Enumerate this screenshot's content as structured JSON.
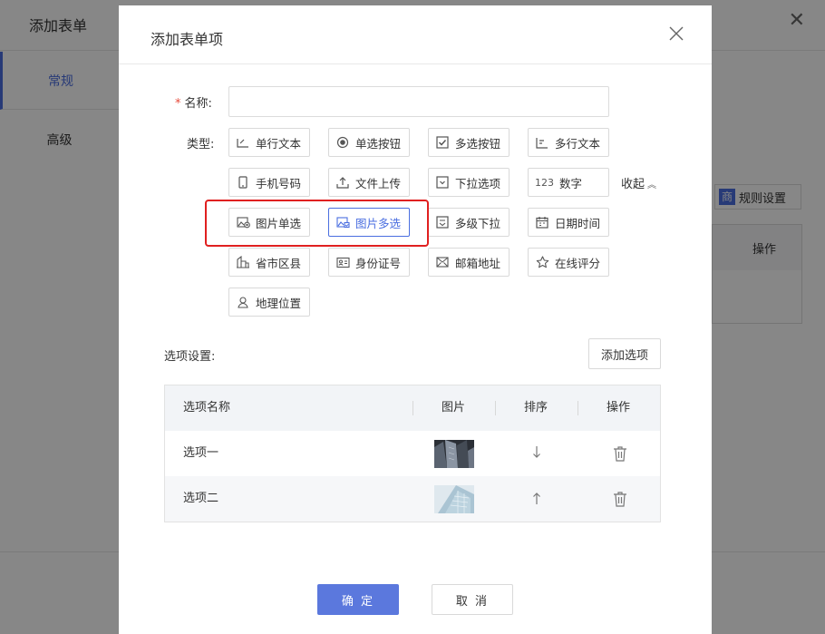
{
  "background": {
    "title": "添加表单",
    "tabs": [
      "常规",
      "高级"
    ],
    "rule_badge": "商",
    "rule_label": "规则设置",
    "table_header": "操作"
  },
  "modal": {
    "title": "添加表单项",
    "name_label": "名称:",
    "name_required_mark": "*",
    "name_value": "",
    "name_placeholder": "",
    "type_label": "类型:",
    "types": [
      {
        "label": "单行文本",
        "icon": "single-line-text-icon"
      },
      {
        "label": "单选按钮",
        "icon": "radio-icon"
      },
      {
        "label": "多选按钮",
        "icon": "checkbox-icon"
      },
      {
        "label": "多行文本",
        "icon": "multi-line-text-icon"
      },
      {
        "label": "手机号码",
        "icon": "phone-icon"
      },
      {
        "label": "文件上传",
        "icon": "upload-icon"
      },
      {
        "label": "下拉选项",
        "icon": "dropdown-icon"
      },
      {
        "label": "数字",
        "icon": "number-icon",
        "icon_text": "123"
      },
      {
        "label": "图片单选",
        "icon": "image-radio-icon"
      },
      {
        "label": "图片多选",
        "icon": "image-multi-icon",
        "selected": true
      },
      {
        "label": "多级下拉",
        "icon": "cascade-icon"
      },
      {
        "label": "日期时间",
        "icon": "calendar-icon"
      },
      {
        "label": "省市区县",
        "icon": "building-icon"
      },
      {
        "label": "身份证号",
        "icon": "id-card-icon"
      },
      {
        "label": "邮箱地址",
        "icon": "mail-icon"
      },
      {
        "label": "在线评分",
        "icon": "star-icon"
      },
      {
        "label": "地理位置",
        "icon": "location-icon"
      }
    ],
    "collapse_label": "收起",
    "options_section_label": "选项设置:",
    "add_option_label": "添加选项",
    "options_table": {
      "headers": [
        "选项名称",
        "图片",
        "排序",
        "操作"
      ],
      "rows": [
        {
          "name": "选项一",
          "sort": "down"
        },
        {
          "name": "选项二",
          "sort": "up"
        }
      ]
    },
    "confirm_label": "确 定",
    "cancel_label": "取 消"
  },
  "colors": {
    "accent": "#5b78dd",
    "selected_border": "#4a6ee0",
    "highlight": "#e02020",
    "required": "#e64a3b"
  }
}
